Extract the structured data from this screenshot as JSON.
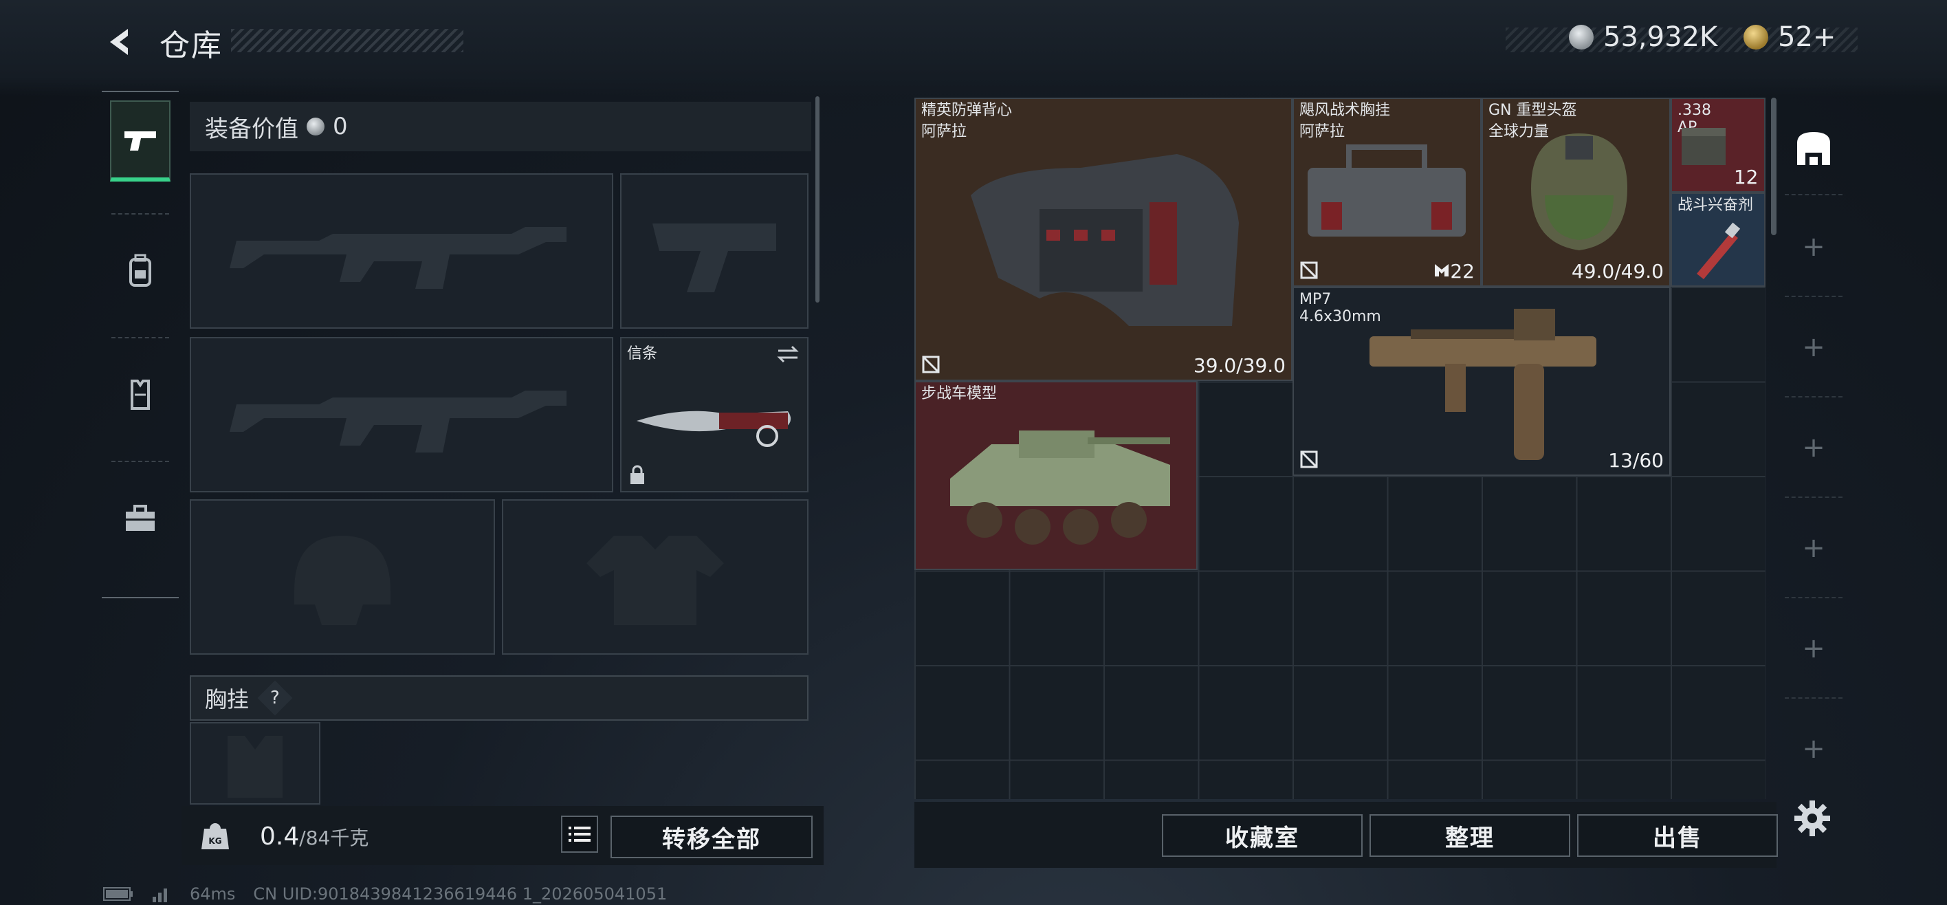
{
  "header": {
    "title": "仓库",
    "back_icon": "back-arrow-icon"
  },
  "currency": {
    "silver": "53,932K",
    "gold": "52+"
  },
  "left_tabs": [
    {
      "icon": "pistol-icon",
      "active": true
    },
    {
      "icon": "backpack-icon",
      "active": false
    },
    {
      "icon": "vest-icon",
      "active": false
    },
    {
      "icon": "toolbox-icon",
      "active": false
    }
  ],
  "equipment": {
    "value_label": "装备价值",
    "value": "0",
    "knife_slot_label": "信条",
    "chest_label": "胸挂",
    "chest_help": "?",
    "weight_current": "0.4",
    "weight_max": "/84千克",
    "transfer_all_label": "转移全部"
  },
  "storage_items": [
    {
      "name": "精英防弹背心",
      "sub": "阿萨拉",
      "stat": "39.0/39.0",
      "color": "#3a2c22"
    },
    {
      "name": "飓风战术胸挂",
      "sub": "阿萨拉",
      "stat": "22",
      "color": "#3a2c22"
    },
    {
      "name": "GN 重型头盔",
      "sub": "全球力量",
      "stat": "49.0/49.0",
      "color": "#3a2c22"
    },
    {
      "name": ".338",
      "sub": "AP",
      "stat": "12",
      "color": "#5a2228"
    },
    {
      "name": "战斗兴奋剂",
      "sub": "",
      "stat": "",
      "color": "#24364a"
    },
    {
      "name": "MP7",
      "sub": "4.6x30mm",
      "stat": "13/60",
      "color": "#1b222a"
    },
    {
      "name": "步战车模型",
      "sub": "",
      "stat": "",
      "color": "#4a2226"
    }
  ],
  "storage_actions": {
    "vault": "收藏室",
    "sort": "整理",
    "sell": "出售"
  },
  "right_strip": {
    "top_icon": "storage-icon",
    "plus": "+",
    "settings_icon": "gear-icon"
  },
  "footer": {
    "ping": "64ms",
    "uid": "CN UID:9018439841236619446 1_202605041051"
  }
}
